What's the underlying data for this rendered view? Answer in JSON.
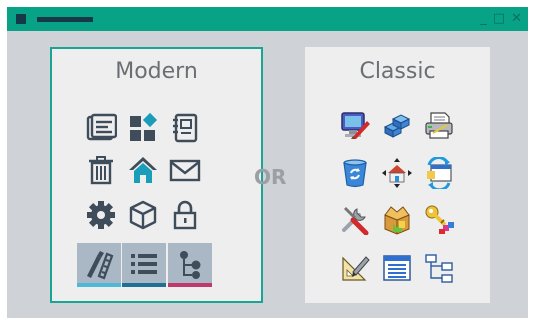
{
  "window": {
    "controls": [
      "_",
      "□",
      "✕"
    ]
  },
  "panels": {
    "modern": {
      "title": "Modern",
      "icons": [
        "tasks-icon",
        "apps-grid-icon",
        "notebook-icon",
        "trash-icon",
        "home-icon",
        "mail-icon",
        "gear-icon",
        "cube-icon",
        "lock-icon"
      ],
      "tiles": [
        {
          "icon": "pen-ruler-icon",
          "bar_color": "#4db8d8"
        },
        {
          "icon": "list-icon",
          "bar_color": "#1f6f96"
        },
        {
          "icon": "tree-icon",
          "bar_color": "#c0396b"
        }
      ]
    },
    "classic": {
      "title": "Classic",
      "icons": [
        "computer-brush-icon",
        "blocks-icon",
        "printer-icon",
        "recycle-bin-icon",
        "move-house-icon",
        "sync-icon",
        "tools-icon",
        "package-icon",
        "key-cubes-icon",
        "ruler-pen-icon",
        "window-list-icon",
        "hierarchy-icon"
      ]
    }
  },
  "separator": {
    "label": "OR"
  },
  "colors": {
    "accent": "#08a387",
    "window_bg": "#cfd2d6",
    "panel_bg": "#eeeeef",
    "text": "#6b6f74"
  }
}
